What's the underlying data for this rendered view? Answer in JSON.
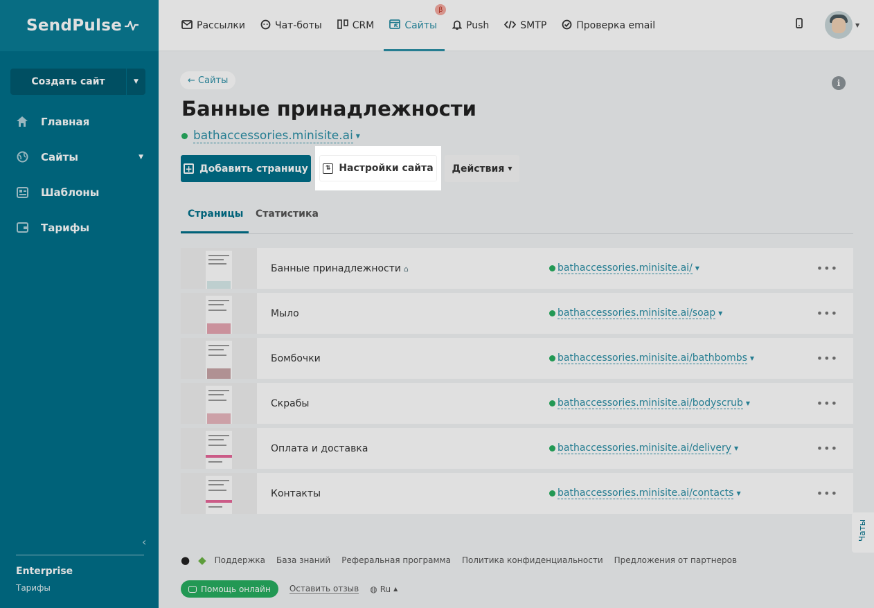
{
  "brand": {
    "name": "SendPulse"
  },
  "sidebar": {
    "create_label": "Создать сайт",
    "items": [
      {
        "label": "Главная",
        "icon": "home-icon"
      },
      {
        "label": "Сайты",
        "icon": "globe-icon"
      },
      {
        "label": "Шаблоны",
        "icon": "templates-icon"
      },
      {
        "label": "Тарифы",
        "icon": "wallet-icon"
      }
    ],
    "plan": "Enterprise",
    "plan_link": "Тарифы"
  },
  "topnav": {
    "items": [
      {
        "label": "Рассылки",
        "icon": "mail-icon"
      },
      {
        "label": "Чат-боты",
        "icon": "chatbot-icon"
      },
      {
        "label": "CRM",
        "icon": "crm-icon"
      },
      {
        "label": "Сайты",
        "icon": "sites-icon",
        "active": true,
        "badge": "β"
      },
      {
        "label": "Push",
        "icon": "bell-icon"
      },
      {
        "label": "SMTP",
        "icon": "code-icon"
      },
      {
        "label": "Проверка email",
        "icon": "check-icon"
      }
    ]
  },
  "main": {
    "back_label": "← Сайты",
    "title": "Банные принадлежности",
    "domain": "bathaccessories.minisite.ai",
    "add_page_label": "Добавить страницу",
    "settings_label": "Настройки сайта",
    "actions_label": "Действия",
    "tabs": [
      {
        "label": "Страницы",
        "active": true
      },
      {
        "label": "Статистика"
      }
    ],
    "pages": [
      {
        "name": "Банные принадлежности",
        "url": "bathaccessories.minisite.ai/",
        "home": true
      },
      {
        "name": "Мыло",
        "url": "bathaccessories.minisite.ai/soap"
      },
      {
        "name": "Бомбочки",
        "url": "bathaccessories.minisite.ai/bathbombs"
      },
      {
        "name": "Скрабы",
        "url": "bathaccessories.minisite.ai/bodyscrub"
      },
      {
        "name": "Оплата и доставка",
        "url": "bathaccessories.minisite.ai/delivery"
      },
      {
        "name": "Контакты",
        "url": "bathaccessories.minisite.ai/contacts"
      }
    ]
  },
  "footer": {
    "links": [
      "Поддержка",
      "База знаний",
      "Реферальная программа",
      "Политика конфиденциальности",
      "Предложения от партнеров"
    ],
    "help_label": "Помощь онлайн",
    "feedback_label": "Оставить отзыв",
    "lang": "Ru"
  },
  "chats_label": "Чаты",
  "colors": {
    "primary": "#00708a",
    "accent": "#2b8fa6",
    "online": "#27ae60"
  }
}
